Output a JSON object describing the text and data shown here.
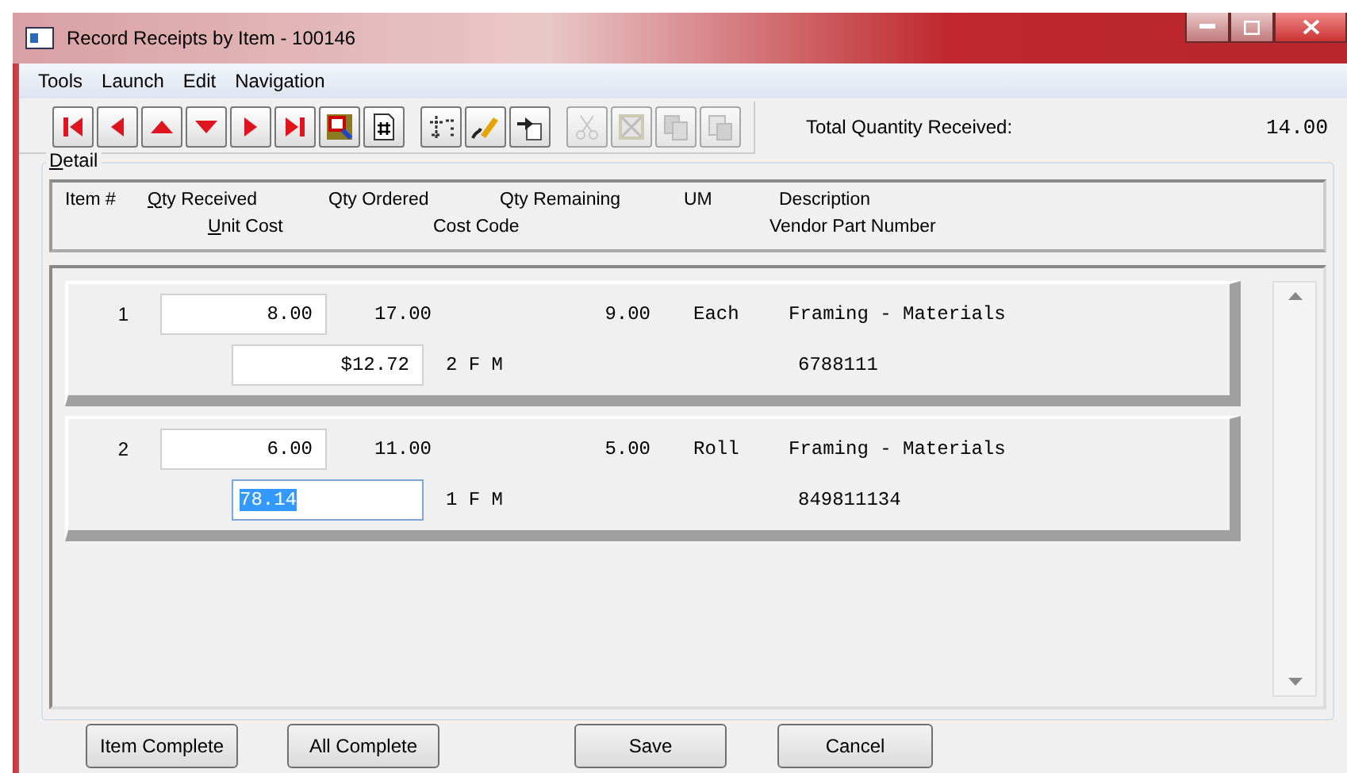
{
  "window": {
    "title": "Record Receipts by Item - 100146"
  },
  "menu": [
    "Tools",
    "Launch",
    "Edit",
    "Navigation"
  ],
  "toolbar": [
    [
      {
        "kind": "first",
        "disabled": false
      },
      {
        "kind": "prev",
        "disabled": false
      },
      {
        "kind": "up",
        "disabled": false
      },
      {
        "kind": "down",
        "disabled": false
      },
      {
        "kind": "next",
        "disabled": false
      },
      {
        "kind": "last",
        "disabled": false
      },
      {
        "kind": "find",
        "disabled": false
      },
      {
        "kind": "calc",
        "disabled": false
      }
    ],
    [
      {
        "kind": "insert",
        "disabled": false
      },
      {
        "kind": "erase",
        "disabled": false
      },
      {
        "kind": "paste",
        "disabled": false
      }
    ],
    [
      {
        "kind": "cut",
        "disabled": true
      },
      {
        "kind": "delete",
        "disabled": true
      },
      {
        "kind": "copy",
        "disabled": true
      },
      {
        "kind": "pastedoc",
        "disabled": true
      }
    ]
  ],
  "total": {
    "label": "Total Quantity Received:",
    "value": "14.00"
  },
  "detail": {
    "title": "Detail",
    "header_line_1": [
      {
        "text": "Item #",
        "underline_first": false
      },
      {
        "text": "Qty Received",
        "underline_first": true
      },
      {
        "text": "Qty Ordered",
        "underline_first": false
      },
      {
        "text": "Qty Remaining",
        "underline_first": false
      },
      {
        "text": "UM",
        "underline_first": false
      },
      {
        "text": "Description",
        "underline_first": false
      }
    ],
    "header_line_2": [
      {
        "text": "Unit Cost",
        "underline_first": true
      },
      {
        "text": "Cost Code",
        "underline_first": false
      },
      {
        "text": "Vendor Part Number",
        "underline_first": false
      }
    ],
    "rows": [
      {
        "item": "1",
        "qty_received": "8.00",
        "qty_ordered": "17.00",
        "qty_remaining": "9.00",
        "um": "Each",
        "description": "Framing - Materials",
        "unit_cost": "$12.72",
        "unit_cost_selected": false,
        "cost_code": "2 F M",
        "vendor_part": "6788111"
      },
      {
        "item": "2",
        "qty_received": "6.00",
        "qty_ordered": "11.00",
        "qty_remaining": "5.00",
        "um": "Roll",
        "description": "Framing - Materials",
        "unit_cost": "78.14",
        "unit_cost_selected": true,
        "cost_code": "1 F M",
        "vendor_part": "849811134"
      }
    ]
  },
  "buttons": [
    "Item Complete",
    "All Complete",
    "Save",
    "Cancel"
  ]
}
